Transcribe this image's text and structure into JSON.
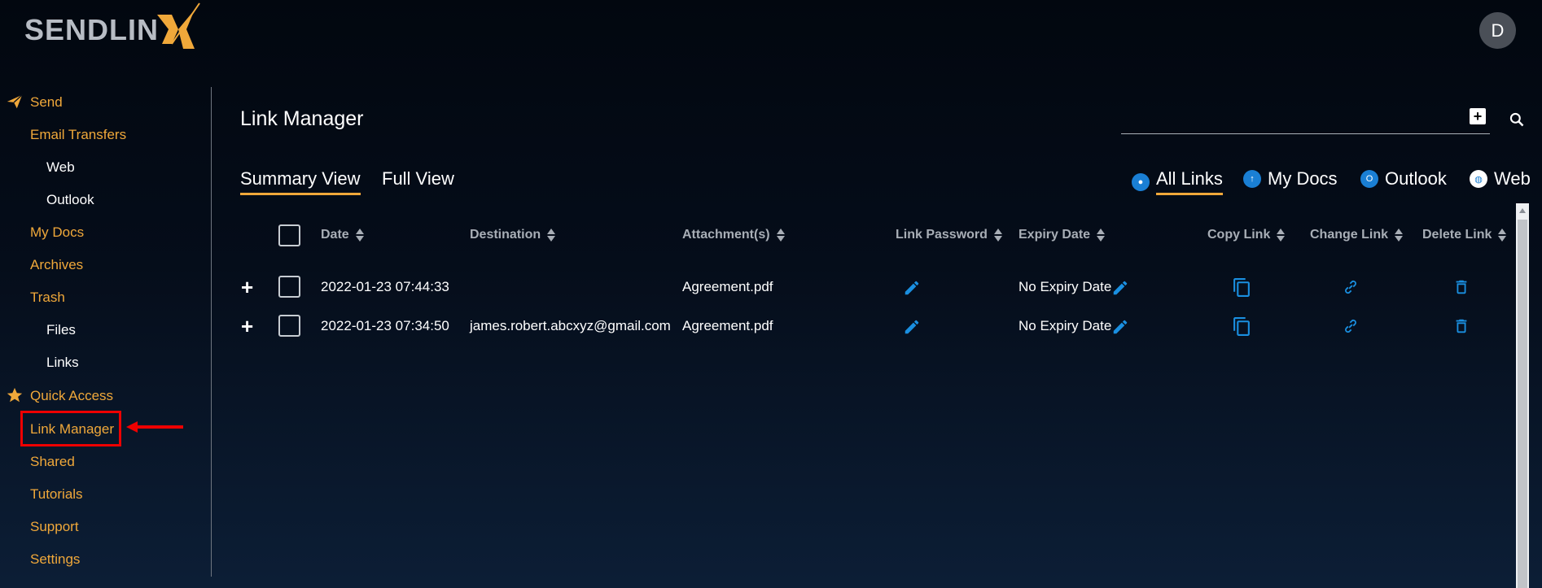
{
  "app": {
    "logo_text": "SENDLIN",
    "avatar_initial": "D"
  },
  "sidebar": {
    "send": "Send",
    "email_transfers": "Email Transfers",
    "web": "Web",
    "outlook": "Outlook",
    "my_docs": "My Docs",
    "archives": "Archives",
    "trash": "Trash",
    "files": "Files",
    "links": "Links",
    "quick_access": "Quick Access",
    "link_manager": "Link Manager",
    "shared": "Shared",
    "tutorials": "Tutorials",
    "support": "Support",
    "settings": "Settings"
  },
  "main": {
    "title": "Link Manager",
    "tabs": {
      "summary": "Summary View",
      "full": "Full View"
    },
    "filters": {
      "all": "All Links",
      "docs": "My Docs",
      "outlook": "Outlook",
      "web": "Web"
    },
    "headers": {
      "date": "Date",
      "destination": "Destination",
      "attachments": "Attachment(s)",
      "link_password": "Link Password",
      "expiry_date": "Expiry Date",
      "copy_link": "Copy Link",
      "change_link": "Change Link",
      "delete_link": "Delete Link"
    },
    "rows": [
      {
        "date": "2022-01-23 07:44:33",
        "destination": "",
        "attachment": "Agreement.pdf",
        "expiry": "No Expiry Date"
      },
      {
        "date": "2022-01-23 07:34:50",
        "destination": "james.robert.abcxyz@gmail.com",
        "attachment": "Agreement.pdf",
        "expiry": "No Expiry Date"
      }
    ]
  },
  "colors": {
    "accent": "#f0a83a",
    "icon_blue": "#1a8fe0",
    "highlight": "#e00000"
  }
}
